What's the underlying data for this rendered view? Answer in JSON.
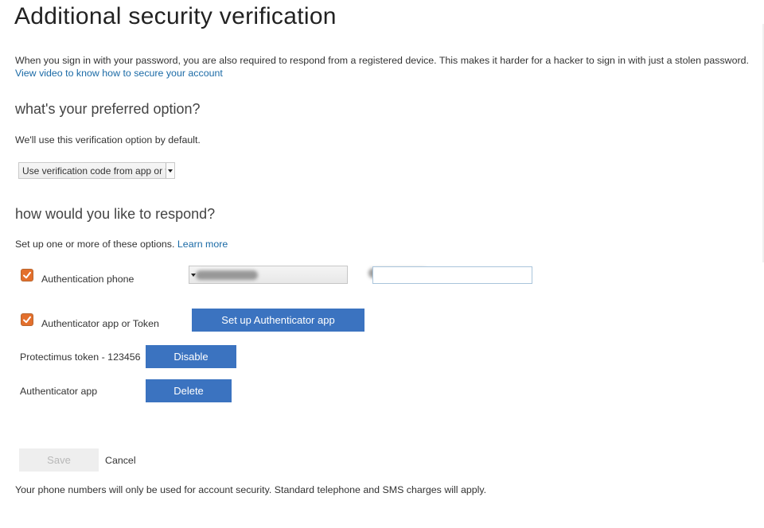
{
  "page": {
    "title": "Additional security verification",
    "intro_text": "When you sign in with your password, you are also required to respond from a registered device. This makes it harder for a hacker to sign in with just a stolen password.",
    "intro_link": "View video to know how to secure your account"
  },
  "preferred": {
    "heading": "what's your preferred option?",
    "description": "We'll use this verification option by default.",
    "selected_value": "Use verification code from app or token"
  },
  "respond": {
    "heading": "how would you like to respond?",
    "description": "Set up one or more of these options.",
    "learn_more": "Learn more",
    "auth_phone": {
      "label": "Authentication phone",
      "checked": true,
      "country_value": "",
      "number_value": ""
    },
    "auth_app": {
      "label": "Authenticator app or Token",
      "checked": true,
      "setup_button": "Set up Authenticator app"
    },
    "devices": [
      {
        "label": "Protectimus token - 123456",
        "action": "Disable"
      },
      {
        "label": "Authenticator app",
        "action": "Delete"
      }
    ]
  },
  "footer": {
    "save": "Save",
    "cancel": "Cancel",
    "note": "Your phone numbers will only be used for account security. Standard telephone and SMS charges will apply."
  },
  "colors": {
    "accent": "#3b73c0",
    "link": "#1a6aa6",
    "checkbox": "#e36f2c"
  },
  "icons": [
    "checkmark-icon",
    "dropdown-arrow-icon"
  ]
}
